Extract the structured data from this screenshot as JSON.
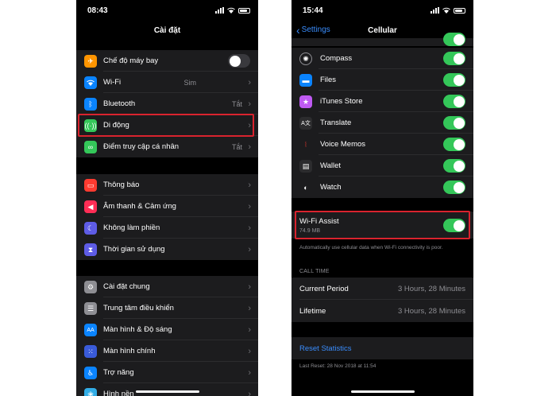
{
  "left": {
    "status_time": "08:43",
    "title": "Cài đặt",
    "groups": [
      [
        {
          "label": "Chế độ máy bay",
          "icon": "airplane-icon",
          "color": "#ff9500",
          "toggle": "off"
        },
        {
          "label": "Wi-Fi",
          "icon": "wifi-icon",
          "color": "#0a84ff",
          "value": "Sim"
        },
        {
          "label": "Bluetooth",
          "icon": "bluetooth-icon",
          "color": "#0a84ff",
          "value": "Tắt"
        },
        {
          "label": "Di động",
          "icon": "cellular-antenna-icon",
          "color": "#34c759"
        },
        {
          "label": "Điểm truy cập cá nhân",
          "icon": "hotspot-link-icon",
          "color": "#34c759",
          "value": "Tắt"
        }
      ],
      [
        {
          "label": "Thông báo",
          "icon": "notifications-icon",
          "color": "#ff3b30"
        },
        {
          "label": "Âm thanh & Cảm ứng",
          "icon": "speaker-icon",
          "color": "#ff2d55"
        },
        {
          "label": "Không làm phiền",
          "icon": "moon-icon",
          "color": "#5e5ce6"
        },
        {
          "label": "Thời gian sử dụng",
          "icon": "hourglass-icon",
          "color": "#5e5ce6"
        }
      ],
      [
        {
          "label": "Cài đặt chung",
          "icon": "gear-icon",
          "color": "#8e8e93"
        },
        {
          "label": "Trung tâm điều khiển",
          "icon": "control-center-icon",
          "color": "#8e8e93"
        },
        {
          "label": "Màn hình & Độ sáng",
          "icon": "display-brightness-icon",
          "color": "#0a84ff"
        },
        {
          "label": "Màn hình chính",
          "icon": "home-screen-grid-icon",
          "color": "#3a5bd9"
        },
        {
          "label": "Trợ năng",
          "icon": "accessibility-icon",
          "color": "#0a84ff"
        },
        {
          "label": "Hình nền",
          "icon": "wallpaper-flower-icon",
          "color": "#32ade6"
        }
      ]
    ]
  },
  "right": {
    "status_time": "15:44",
    "back_label": "Settings",
    "title": "Cellular",
    "apps": [
      {
        "label": "Compass",
        "icon": "compass-icon",
        "color": "#1c1c1e"
      },
      {
        "label": "Files",
        "icon": "folder-icon",
        "color": "#0a84ff"
      },
      {
        "label": "iTunes Store",
        "icon": "star-icon",
        "color": "#bf5af2"
      },
      {
        "label": "Translate",
        "icon": "translate-icon",
        "color": "#1c1c1e"
      },
      {
        "label": "Voice Memos",
        "icon": "waveform-icon",
        "color": "#1c1c1e"
      },
      {
        "label": "Wallet",
        "icon": "wallet-icon",
        "color": "#1c1c1e"
      },
      {
        "label": "Watch",
        "icon": "watch-icon",
        "color": "#1c1c1e"
      }
    ],
    "wifi_assist": {
      "label": "Wi-Fi Assist",
      "usage": "74.9 MB",
      "note": "Automatically use cellular data when Wi-Fi connectivity is poor."
    },
    "call_time_header": "CALL TIME",
    "call_time": [
      {
        "label": "Current Period",
        "value": "3 Hours, 28 Minutes"
      },
      {
        "label": "Lifetime",
        "value": "3 Hours, 28 Minutes"
      }
    ],
    "reset_label": "Reset Statistics",
    "last_reset": "Last Reset: 28 Nov 2018 at 11:54"
  },
  "colors": {
    "accent": "#3a8dfd",
    "toggle_on": "#34c759",
    "highlight": "#d9232e"
  }
}
